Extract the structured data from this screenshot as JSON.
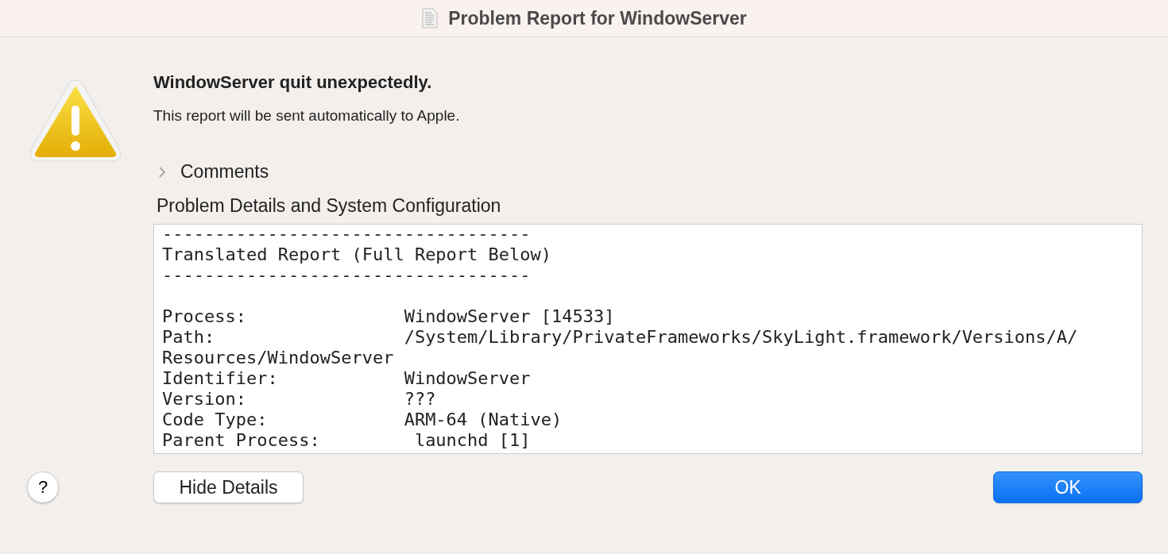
{
  "window": {
    "title": "Problem Report for WindowServer"
  },
  "alert": {
    "heading": "WindowServer quit unexpectedly.",
    "message": "This report will be sent automatically to Apple."
  },
  "comments": {
    "label": "Comments",
    "expanded": false
  },
  "details": {
    "label": "Problem Details and System Configuration",
    "banner": [
      "-----------------------------------",
      "Translated Report (Full Report Below)",
      "-----------------------------------"
    ],
    "lines": [
      "Process:               WindowServer [14533]",
      "Path:                  /System/Library/PrivateFrameworks/SkyLight.framework/Versions/A/",
      "Resources/WindowServer",
      "Identifier:            WindowServer",
      "Version:               ???",
      "Code Type:             ARM-64 (Native)",
      "Parent Process:         launchd [1]"
    ]
  },
  "buttons": {
    "help": "?",
    "toggle_details": "Hide Details",
    "ok": "OK"
  }
}
